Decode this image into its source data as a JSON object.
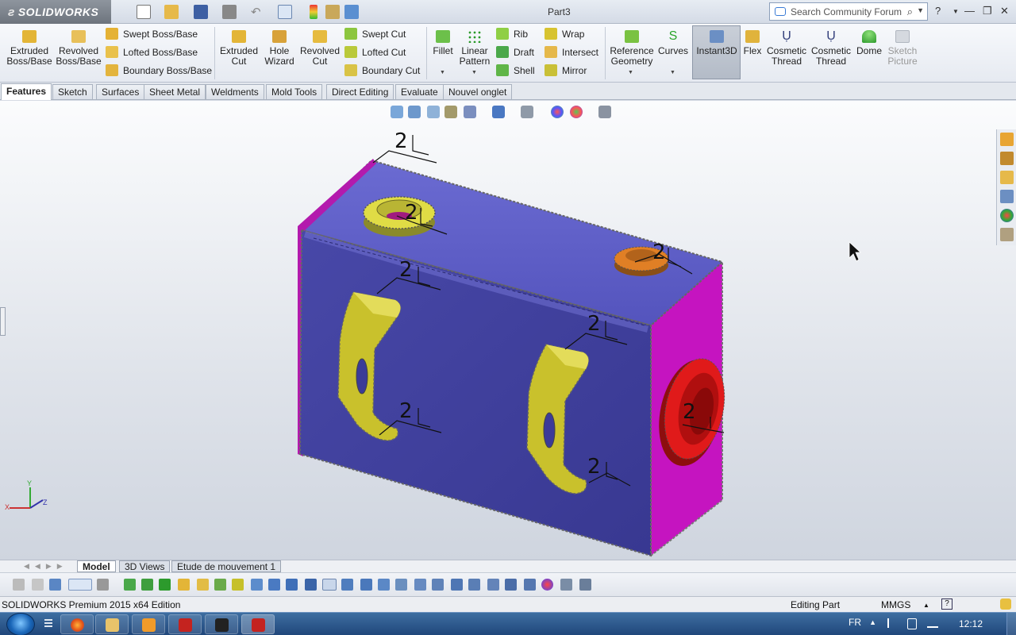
{
  "app": {
    "brand": "SOLIDWORKS",
    "document_title": "Part3",
    "search_placeholder": "Search Community Forum"
  },
  "ribbon": {
    "extruded_boss": "Extruded Boss/Base",
    "revolved_boss": "Revolved Boss/Base",
    "swept_boss": "Swept Boss/Base",
    "lofted_boss": "Lofted Boss/Base",
    "boundary_boss": "Boundary Boss/Base",
    "extruded_cut": "Extruded Cut",
    "hole_wizard": "Hole Wizard",
    "revolved_cut": "Revolved Cut",
    "swept_cut": "Swept Cut",
    "lofted_cut": "Lofted Cut",
    "boundary_cut": "Boundary Cut",
    "fillet": "Fillet",
    "linear_pattern": "Linear Pattern",
    "rib": "Rib",
    "draft": "Draft",
    "shell": "Shell",
    "wrap": "Wrap",
    "intersect": "Intersect",
    "mirror": "Mirror",
    "reference_geometry": "Reference Geometry",
    "curves": "Curves",
    "instant3d": "Instant3D",
    "flex": "Flex",
    "cosmetic_thread_1": "Cosmetic Thread",
    "cosmetic_thread_2": "Cosmetic Thread",
    "dome": "Dome",
    "sketch_picture": "Sketch Picture"
  },
  "tabs": [
    "Features",
    "Sketch",
    "Surfaces",
    "Sheet Metal",
    "Weldments",
    "Mold Tools",
    "Direct Editing",
    "Evaluate",
    "Nouvel onglet"
  ],
  "model": {
    "weld_label": "2",
    "colors": {
      "front": "#3f3f9f",
      "top": "#5c5cc4",
      "side": "#c40fbf",
      "boss_yellow": "#d6d43a",
      "boss_orange": "#d97a23",
      "bracket": "#c9c22e",
      "port_red": "#e0191a"
    }
  },
  "bottom_tabs": [
    "Model",
    "3D Views",
    "Etude de mouvement 1"
  ],
  "status": {
    "edition": "SOLIDWORKS Premium 2015 x64 Edition",
    "mode": "Editing Part",
    "units": "MMGS"
  },
  "taskbar": {
    "lang": "FR",
    "clock": "12:12"
  }
}
